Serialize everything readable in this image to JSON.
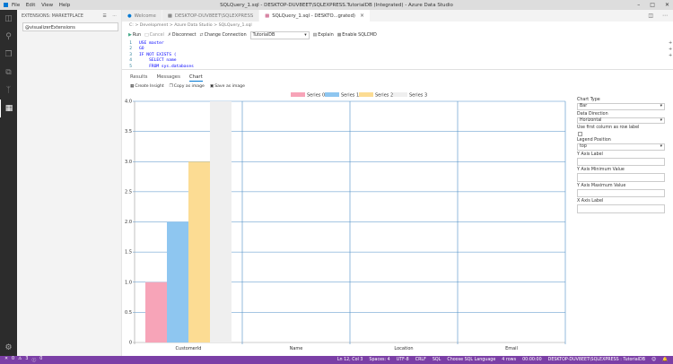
{
  "window": {
    "title": "SQLQuery_1.sql - DESKTOP-DUV8EET\\SQLEXPRESS.TutorialDB (Integrated) - Azure Data Studio",
    "menu": [
      "File",
      "Edit",
      "View",
      "Help"
    ]
  },
  "sidebar": {
    "header": "EXTENSIONS: MARKETPLACE",
    "search_value": "@visualizerExtensions"
  },
  "tabs": [
    {
      "label": "Welcome"
    },
    {
      "label": "DESKTOP-DUV8EET\\SQLEXPRESS"
    },
    {
      "label": "SQLQuery_1.sql - DESKTO...grated)",
      "close": "×"
    }
  ],
  "breadcrumb": "C: > Development > Azure Data Studio > SQLQuery_1.sql",
  "toolbar": {
    "run": "Run",
    "cancel": "Cancel",
    "disconnect": "Disconnect",
    "change_connection": "Change Connection",
    "database": "TutorialDB",
    "explain": "Explain",
    "sqlcmd": "Enable SQLCMD"
  },
  "code": [
    {
      "n": "1",
      "text": "USE master"
    },
    {
      "n": "2",
      "text": "GO"
    },
    {
      "n": "3",
      "text": "IF NOT EXISTS ("
    },
    {
      "n": "4",
      "text": "    SELECT name"
    },
    {
      "n": "5",
      "text": "    FROM sys.databases"
    }
  ],
  "results_tabs": {
    "results": "Results",
    "messages": "Messages",
    "chart": "Chart"
  },
  "chart_actions": {
    "insight": "Create Insight",
    "copy": "Copy as image",
    "save": "Save as image"
  },
  "chart_options": {
    "chart_type_label": "Chart Type",
    "chart_type": "Bar",
    "data_direction_label": "Data Direction",
    "data_direction": "Horizontal",
    "first_column_label": "Use first column as row label",
    "legend_position_label": "Legend Position",
    "legend_position": "top",
    "y_axis_label": "Y Axis Label",
    "y_min_label": "Y Axis Minimum Value",
    "y_max_label": "Y Axis Maximum Value",
    "x_axis_label": "X Axis Label"
  },
  "colors": {
    "series": [
      "#f7a4b8",
      "#8ec6f0",
      "#fcdc93",
      "#efefef"
    ],
    "accent": "#0078d4",
    "statusbar": "#7b3fa6"
  },
  "chart_data": {
    "type": "bar",
    "categories": [
      "CustomerId",
      "Name",
      "Location",
      "Email"
    ],
    "series": [
      {
        "name": "Series 0",
        "values": [
          1,
          null,
          null,
          null
        ]
      },
      {
        "name": "Series 1",
        "values": [
          2,
          null,
          null,
          null
        ]
      },
      {
        "name": "Series 2",
        "values": [
          3,
          null,
          null,
          null
        ]
      },
      {
        "name": "Series 3",
        "values": [
          4,
          null,
          null,
          null
        ]
      }
    ],
    "ylim": [
      0,
      4
    ],
    "yticks": [
      "0",
      "0.5",
      "1.0",
      "1.5",
      "2.0",
      "2.5",
      "3.0",
      "3.5",
      "4.0"
    ],
    "legend": "top",
    "grid": true
  },
  "statusbar": {
    "errors": "0",
    "warnings": "3",
    "info": "0",
    "position": "Ln 12, Col 3",
    "spaces": "Spaces: 4",
    "encoding": "UTF-8",
    "eol": "CRLF",
    "language": "SQL",
    "choose_language": "Choose SQL Language",
    "rows": "4 rows",
    "time": "00:00:00",
    "connection": "DESKTOP-DUV8EET\\SQLEXPRESS : TutorialDB"
  }
}
